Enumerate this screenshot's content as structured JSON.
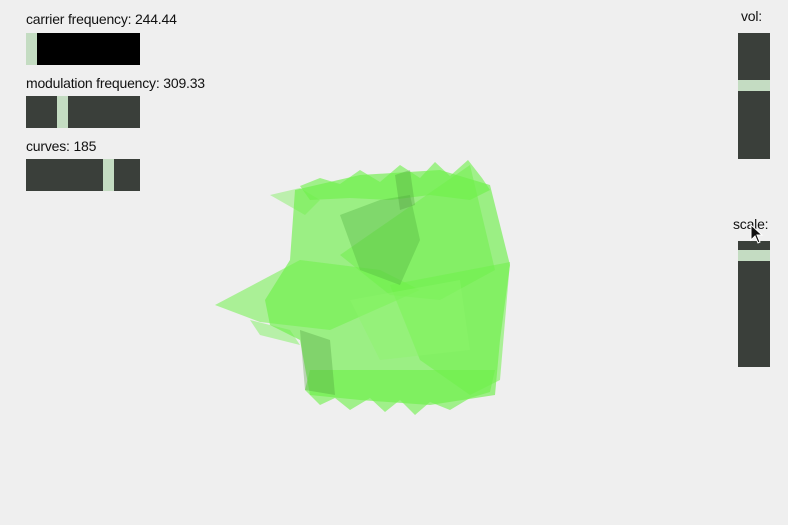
{
  "controls": {
    "carrier": {
      "label": "carrier frequency:",
      "value": "244.44",
      "level": 0.0
    },
    "modulation": {
      "label": "modulation frequency:",
      "value": "309.33",
      "level": 0.3
    },
    "curves": {
      "label": "curves:",
      "value": "185",
      "level": 0.75
    },
    "vol": {
      "label": "vol:",
      "level": 0.59
    },
    "scale": {
      "label": "scale:",
      "level": 0.92
    }
  },
  "visual": {
    "fill_color": "#6ef04a",
    "background_color": "#efefef",
    "slider_track_color": "#3a3f3a",
    "slider_handle_color": "#c4dcc2"
  }
}
